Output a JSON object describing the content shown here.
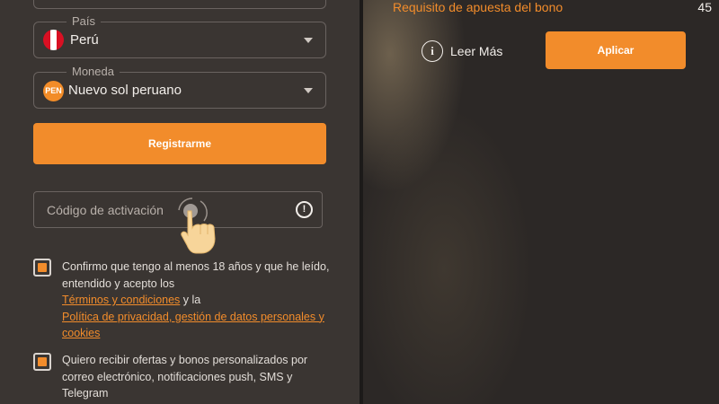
{
  "form": {
    "country": {
      "legend": "País",
      "value": "Perú"
    },
    "currency": {
      "legend": "Moneda",
      "value": "Nuevo sol peruano",
      "badge": "PEN"
    },
    "register_label": "Registrarme",
    "activation": {
      "placeholder": "Código de activación",
      "info_glyph": "!"
    },
    "consent_age": {
      "checked": true,
      "text_1": "Confirmo que tengo al menos 18 años y que he leído, entendido y acepto los",
      "link_terms": "Términos y condiciones",
      "text_2": " y la",
      "link_privacy": "Política de privacidad, gestión de datos personales y cookies"
    },
    "consent_marketing": {
      "checked": true,
      "text": "Quiero recibir ofertas y bonos personalizados por correo electrónico, notificaciones push, SMS y Telegram"
    }
  },
  "promo": {
    "bonus_label": "Requisito de apuesta del bono",
    "bonus_value": "45",
    "read_more_glyph": "i",
    "read_more_label": "Leer Más",
    "apply_label": "Aplicar"
  },
  "icons": [
    "peru-flag-icon",
    "chevron-down-icon",
    "currency-badge-icon",
    "info-icon",
    "tap-hand-icon"
  ],
  "colors": {
    "accent": "#f28c2b",
    "panel": "#3a3532",
    "background": "#2a2624"
  }
}
